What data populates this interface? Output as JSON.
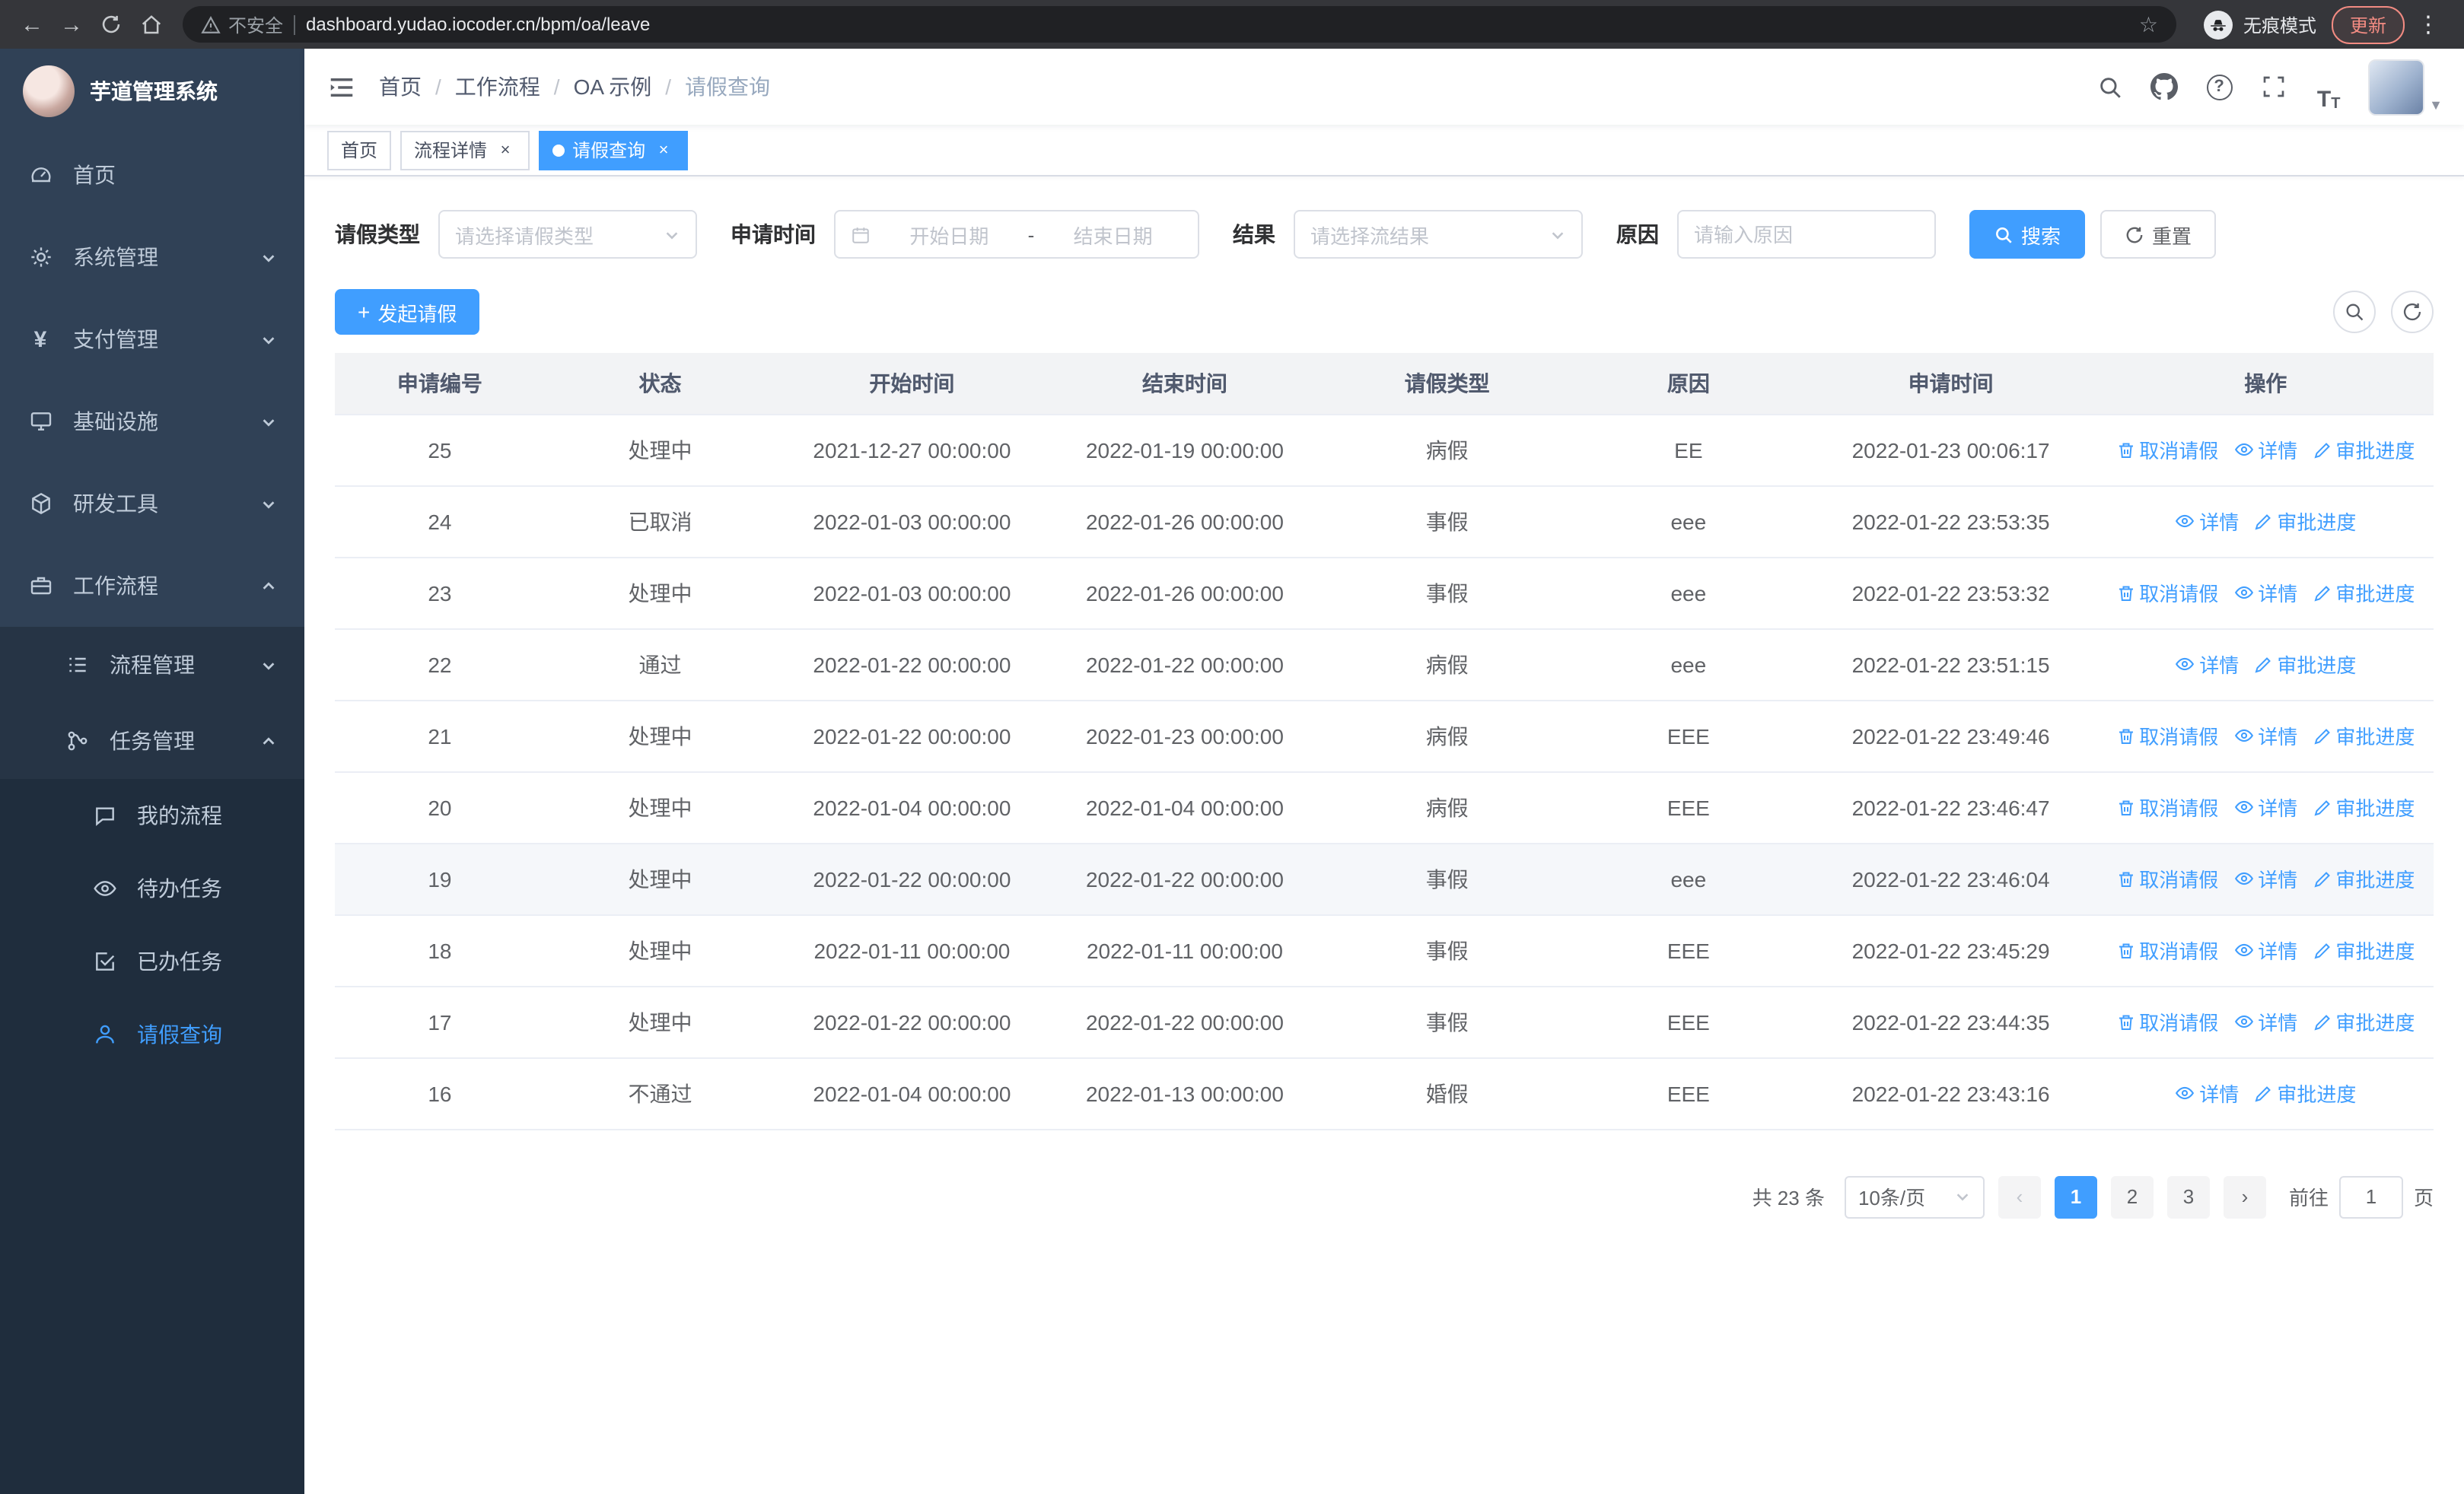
{
  "browser": {
    "security_warning": "不安全",
    "url": "dashboard.yudao.iocoder.cn/bpm/oa/leave",
    "incognito_label": "无痕模式",
    "update_label": "更新"
  },
  "sidebar": {
    "logo_title": "芋道管理系统",
    "items": [
      {
        "label": "首页",
        "icon": "dashboard-icon"
      },
      {
        "label": "系统管理",
        "icon": "gear-icon"
      },
      {
        "label": "支付管理",
        "icon": "payment-icon"
      },
      {
        "label": "基础设施",
        "icon": "infrastructure-icon"
      },
      {
        "label": "研发工具",
        "icon": "devtools-icon"
      },
      {
        "label": "工作流程",
        "icon": "workflow-icon"
      }
    ],
    "submenu": [
      {
        "label": "流程管理",
        "icon": "process-icon"
      },
      {
        "label": "任务管理",
        "icon": "task-icon"
      }
    ],
    "subsubmenu": [
      {
        "label": "我的流程",
        "icon": "my-process-icon"
      },
      {
        "label": "待办任务",
        "icon": "todo-icon"
      },
      {
        "label": "已办任务",
        "icon": "done-icon"
      },
      {
        "label": "请假查询",
        "icon": "leave-query-icon"
      }
    ]
  },
  "header": {
    "breadcrumbs": [
      "首页",
      "工作流程",
      "OA 示例",
      "请假查询"
    ],
    "crumb_separator": "/"
  },
  "tags": [
    {
      "label": "首页"
    },
    {
      "label": "流程详情"
    },
    {
      "label": "请假查询"
    }
  ],
  "filters": {
    "leave_type_label": "请假类型",
    "leave_type_placeholder": "请选择请假类型",
    "apply_time_label": "申请时间",
    "start_date_placeholder": "开始日期",
    "range_separator": "-",
    "end_date_placeholder": "结束日期",
    "result_label": "结果",
    "result_placeholder": "请选择流结果",
    "reason_label": "原因",
    "reason_placeholder": "请输入原因",
    "search_button": "搜索",
    "reset_button": "重置"
  },
  "toolbar": {
    "create_button": "发起请假"
  },
  "table": {
    "columns": [
      "申请编号",
      "状态",
      "开始时间",
      "结束时间",
      "请假类型",
      "原因",
      "申请时间",
      "操作"
    ],
    "action_labels": {
      "cancel": "取消请假",
      "detail": "详情",
      "progress": "审批进度"
    },
    "action_icons": {
      "cancel": "trash-icon",
      "detail": "eye-icon",
      "progress": "edit-icon"
    },
    "rows": [
      {
        "id": "25",
        "status": "处理中",
        "start": "2021-12-27 00:00:00",
        "end": "2022-01-19 00:00:00",
        "type": "病假",
        "reason": "EE",
        "applied": "2022-01-23 00:06:17",
        "actions": [
          "cancel",
          "detail",
          "progress"
        ]
      },
      {
        "id": "24",
        "status": "已取消",
        "start": "2022-01-03 00:00:00",
        "end": "2022-01-26 00:00:00",
        "type": "事假",
        "reason": "eee",
        "applied": "2022-01-22 23:53:35",
        "actions": [
          "detail",
          "progress"
        ]
      },
      {
        "id": "23",
        "status": "处理中",
        "start": "2022-01-03 00:00:00",
        "end": "2022-01-26 00:00:00",
        "type": "事假",
        "reason": "eee",
        "applied": "2022-01-22 23:53:32",
        "actions": [
          "cancel",
          "detail",
          "progress"
        ]
      },
      {
        "id": "22",
        "status": "通过",
        "start": "2022-01-22 00:00:00",
        "end": "2022-01-22 00:00:00",
        "type": "病假",
        "reason": "eee",
        "applied": "2022-01-22 23:51:15",
        "actions": [
          "detail",
          "progress"
        ]
      },
      {
        "id": "21",
        "status": "处理中",
        "start": "2022-01-22 00:00:00",
        "end": "2022-01-23 00:00:00",
        "type": "病假",
        "reason": "EEE",
        "applied": "2022-01-22 23:49:46",
        "actions": [
          "cancel",
          "detail",
          "progress"
        ]
      },
      {
        "id": "20",
        "status": "处理中",
        "start": "2022-01-04 00:00:00",
        "end": "2022-01-04 00:00:00",
        "type": "病假",
        "reason": "EEE",
        "applied": "2022-01-22 23:46:47",
        "actions": [
          "cancel",
          "detail",
          "progress"
        ]
      },
      {
        "id": "19",
        "status": "处理中",
        "start": "2022-01-22 00:00:00",
        "end": "2022-01-22 00:00:00",
        "type": "事假",
        "reason": "eee",
        "applied": "2022-01-22 23:46:04",
        "actions": [
          "cancel",
          "detail",
          "progress"
        ],
        "highlighted": true
      },
      {
        "id": "18",
        "status": "处理中",
        "start": "2022-01-11 00:00:00",
        "end": "2022-01-11 00:00:00",
        "type": "事假",
        "reason": "EEE",
        "applied": "2022-01-22 23:45:29",
        "actions": [
          "cancel",
          "detail",
          "progress"
        ]
      },
      {
        "id": "17",
        "status": "处理中",
        "start": "2022-01-22 00:00:00",
        "end": "2022-01-22 00:00:00",
        "type": "事假",
        "reason": "EEE",
        "applied": "2022-01-22 23:44:35",
        "actions": [
          "cancel",
          "detail",
          "progress"
        ]
      },
      {
        "id": "16",
        "status": "不通过",
        "start": "2022-01-04 00:00:00",
        "end": "2022-01-13 00:00:00",
        "type": "婚假",
        "reason": "EEE",
        "applied": "2022-01-22 23:43:16",
        "actions": [
          "detail",
          "progress"
        ]
      }
    ]
  },
  "pagination": {
    "total_text": "共 23 条",
    "page_size": "10条/页",
    "pages": [
      "1",
      "2",
      "3"
    ],
    "active_page": "1",
    "goto_label": "前往",
    "goto_value": "1",
    "page_suffix": "页"
  }
}
